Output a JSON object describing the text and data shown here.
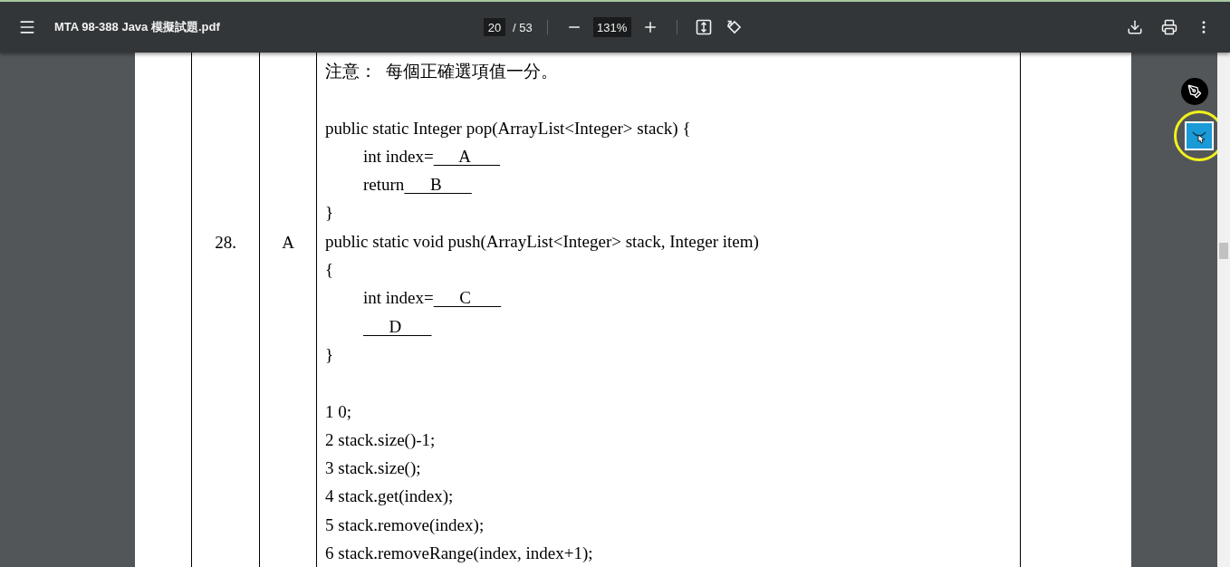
{
  "toolbar": {
    "title": "MTA 98-388 Java 模擬試題.pdf",
    "page_input": "20",
    "page_total": "/ 53",
    "zoom": "131%"
  },
  "question": {
    "number": "28.",
    "answer": "A",
    "lines": [
      {
        "kind": "text",
        "text": "注意：  每個正確選項值一分。",
        "indent": false
      },
      {
        "kind": "empty"
      },
      {
        "kind": "text",
        "text": "public static Integer pop(ArrayList<Integer> stack) {",
        "indent": false
      },
      {
        "kind": "fill",
        "prefix": "int index=",
        "answer": "A",
        "indent": true
      },
      {
        "kind": "fill",
        "prefix": "return",
        "answer": "B",
        "indent": true
      },
      {
        "kind": "text",
        "text": "}",
        "indent": false
      },
      {
        "kind": "text",
        "text": "public static void push(ArrayList<Integer> stack, Integer item)",
        "indent": false
      },
      {
        "kind": "text",
        "text": "{",
        "indent": false
      },
      {
        "kind": "fill",
        "prefix": "int index=",
        "answer": "C",
        "indent": true
      },
      {
        "kind": "fill",
        "answer": "D",
        "indent": true
      },
      {
        "kind": "text",
        "text": "}",
        "indent": false
      },
      {
        "kind": "empty"
      },
      {
        "kind": "text",
        "text": "1 0;",
        "indent": false
      },
      {
        "kind": "text",
        "text": "2 stack.size()-1;",
        "indent": false
      },
      {
        "kind": "text",
        "text": "3 stack.size();",
        "indent": false
      },
      {
        "kind": "text",
        "text": "4 stack.get(index);",
        "indent": false
      },
      {
        "kind": "text",
        "text": "5 stack.remove(index);",
        "indent": false
      },
      {
        "kind": "text",
        "text": "6 stack.removeRange(index, index+1);",
        "indent": false
      }
    ]
  }
}
